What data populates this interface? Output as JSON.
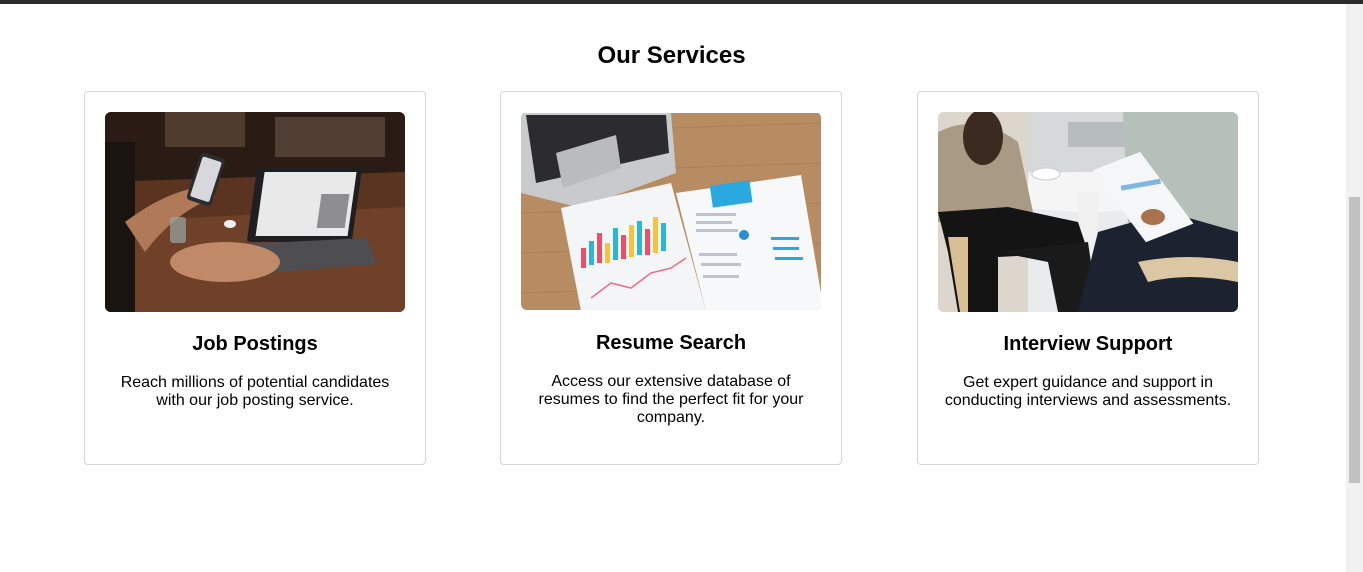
{
  "section": {
    "title": "Our Services"
  },
  "services": [
    {
      "title": "Job Postings",
      "description": "Reach millions of potential candidates with our job posting service.",
      "image": "laptop-phone-photo"
    },
    {
      "title": "Resume Search",
      "description": "Access our extensive database of resumes to find the perfect fit for your company.",
      "image": "resume-documents-photo"
    },
    {
      "title": "Interview Support",
      "description": "Get expert guidance and support in conducting interviews and assessments.",
      "image": "interview-meeting-photo"
    }
  ]
}
